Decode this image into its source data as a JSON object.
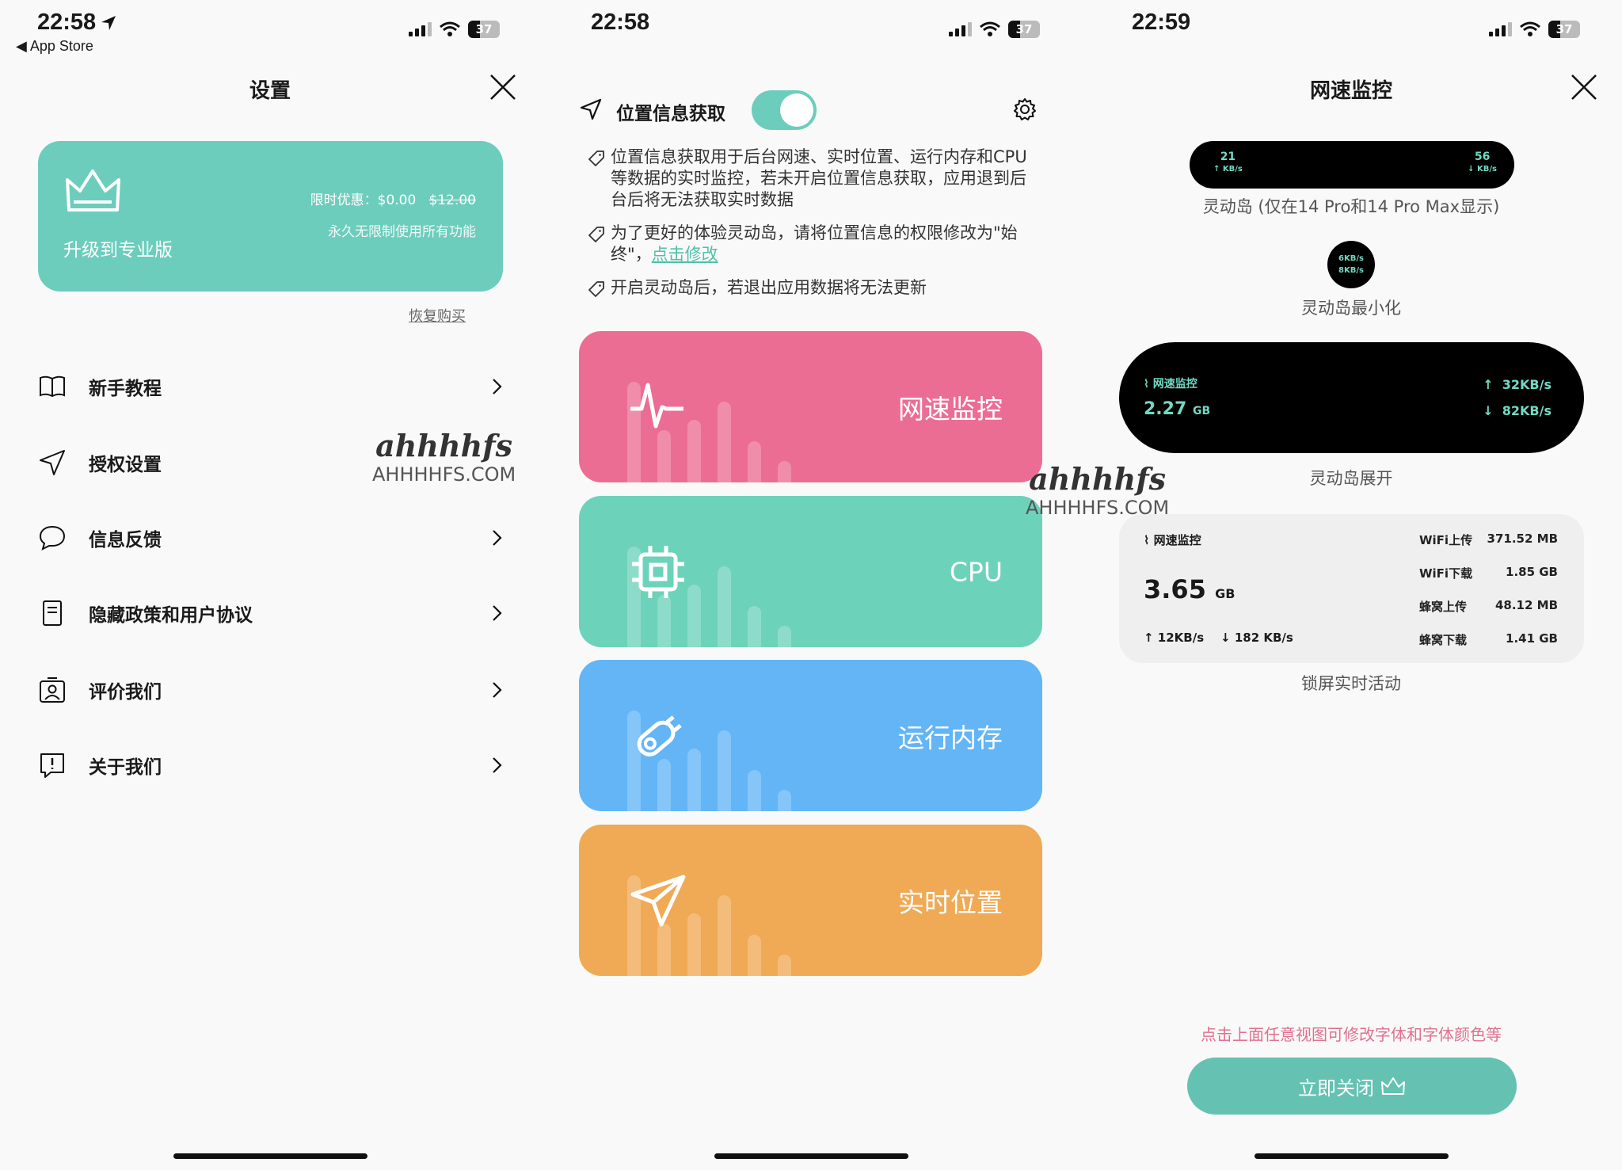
{
  "watermark": {
    "brand": "ahhhhfs",
    "site": "AHHHHFS.COM"
  },
  "settings_screen": {
    "status": {
      "time": "22:58",
      "back_label": "App Store",
      "battery": "37"
    },
    "title": "设置",
    "pro_card": {
      "title": "升级到专业版",
      "promo": "限时优惠：$0.00",
      "old_price": "$12.00",
      "subtitle": "永久无限制使用所有功能",
      "icon": "crown-icon"
    },
    "restore_label": "恢复购买",
    "menu": [
      {
        "label": "新手教程",
        "icon": "book-icon"
      },
      {
        "label": "授权设置",
        "icon": "navigation-icon"
      },
      {
        "label": "信息反馈",
        "icon": "chat-bubble-icon"
      },
      {
        "label": "隐藏政策和用户协议",
        "icon": "document-icon"
      },
      {
        "label": "评价我们",
        "icon": "rate-icon"
      },
      {
        "label": "关于我们",
        "icon": "info-bubble-icon"
      }
    ]
  },
  "home_screen": {
    "status": {
      "time": "22:58",
      "battery": "37"
    },
    "location": {
      "label": "位置信息获取",
      "enabled": true
    },
    "notes": [
      {
        "text": "位置信息获取用于后台网速、实时位置、运行内存和CPU 等数据的实时监控，若未开启位置信息获取，应用退到后台后将无法获取实时数据"
      },
      {
        "text": "为了更好的体验灵动岛，请将位置信息的权限修改为\"始终\"，",
        "link": "点击修改"
      },
      {
        "text": "开启灵动岛后，若退出应用数据将无法更新"
      }
    ],
    "cards": [
      {
        "label": "网速监控",
        "color": "#ec6d93",
        "icon": "pulse-icon"
      },
      {
        "label": "CPU",
        "color": "#6dd2ba",
        "icon": "chip-icon"
      },
      {
        "label": "运行内存",
        "color": "#63b5f6",
        "icon": "memory-icon"
      },
      {
        "label": "实时位置",
        "color": "#f0aa55",
        "icon": "location-arrow-icon"
      }
    ]
  },
  "monitor_screen": {
    "status": {
      "time": "22:59",
      "battery": "37"
    },
    "title": "网速监控",
    "island": {
      "up": "21",
      "down": "56",
      "unit": "KB/s",
      "caption": "灵动岛 (仅在14 Pro和14 Pro Max显示)"
    },
    "island_min": {
      "up": "6KB/s",
      "down": "8KB/s",
      "caption": "灵动岛最小化"
    },
    "island_expanded": {
      "label": "网速监控",
      "total": "2.27",
      "total_unit": "GB",
      "up": "32KB/s",
      "down": "82KB/s",
      "caption": "灵动岛展开"
    },
    "lock_screen": {
      "label": "网速监控",
      "total": "3.65",
      "total_unit": "GB",
      "up": "12KB/s",
      "down": "182 KB/s",
      "rows": [
        {
          "label": "WiFi上传",
          "value": "371.52 MB"
        },
        {
          "label": "WiFi下载",
          "value": "1.85 GB"
        },
        {
          "label": "蜂窝上传",
          "value": "48.12 MB"
        },
        {
          "label": "蜂窝下载",
          "value": "1.41 GB"
        }
      ],
      "caption": "锁屏实时活动"
    },
    "hint": "点击上面任意视图可修改字体和字体颜色等",
    "close_button": "立即关闭",
    "accent": "#65c2b2",
    "hint_color": "#e0708f"
  }
}
